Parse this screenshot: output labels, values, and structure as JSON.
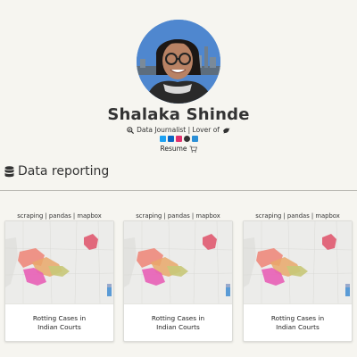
{
  "profile": {
    "name": "Shalaka Shinde",
    "tagline": "Data Journalist | Lover of",
    "resume_label": "Resume"
  },
  "icons": {
    "tagline_prefix": "magnifier-chart-icon",
    "tagline_suffix": "bird-icon",
    "resume_suffix": "cart-icon",
    "section": "database-icon",
    "social": [
      "twitter-icon",
      "linkedin-icon",
      "instagram-icon",
      "github-icon",
      "email-icon"
    ]
  },
  "colors": {
    "background": "#f6f5f0",
    "twitter": "#1da1f2",
    "linkedin": "#0a66c2",
    "instagram": "#e1306c",
    "github": "#333333",
    "email": "#2b8fd6"
  },
  "section": {
    "title": "Data reporting"
  },
  "cards": [
    {
      "tags": "scraping | pandas | mapbox",
      "caption": "Rotting Cases in\nIndian Courts"
    },
    {
      "tags": "scraping | pandas | mapbox",
      "caption": "Rotting Cases in\nIndian Courts"
    },
    {
      "tags": "scraping | pandas | mapbox",
      "caption": "Rotting Cases in\nIndian Courts"
    }
  ]
}
